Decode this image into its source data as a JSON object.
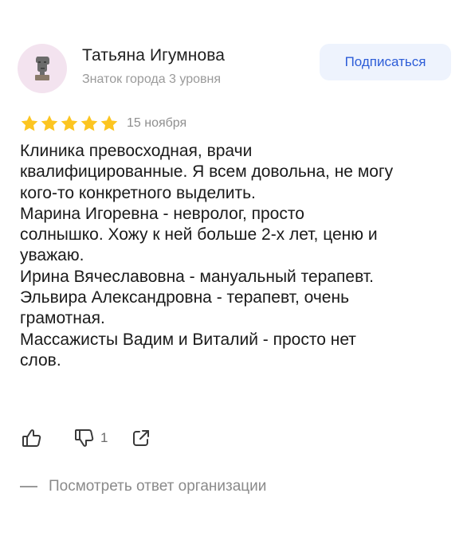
{
  "author": {
    "name": "Татьяна Игумнова",
    "status": "Знаток города 3 уровня",
    "avatar_icon": "moai-statue-icon",
    "avatar_bg": "#f3e3ef"
  },
  "subscribe": {
    "label": "Подписаться",
    "color": "#2d5dd8",
    "background": "#eef3fd"
  },
  "rating": {
    "stars": 5,
    "max": 5,
    "star_color": "#fcc521"
  },
  "date": "15 ноября",
  "review_text": "Клиника превосходная, врачи\nквалифицированные. Я всем довольна, не могу\nкого-то конкретного выделить.\nМарина Игоревна - невролог, просто\nсолнышко. Хожу к ней больше 2-х лет, ценю и\nуважаю.\nИрина Вячеславовна - мануальный терапевт.\nЭльвира Александровна - терапевт, очень\nграмотная.\nМассажисты Вадим и Виталий - просто нет\nслов.",
  "actions": {
    "like_icon": "thumbs-up-icon",
    "dislike_icon": "thumbs-down-icon",
    "dislike_count": "1",
    "share_icon": "share-icon"
  },
  "org_answer": {
    "label": "Посмотреть ответ организации"
  }
}
